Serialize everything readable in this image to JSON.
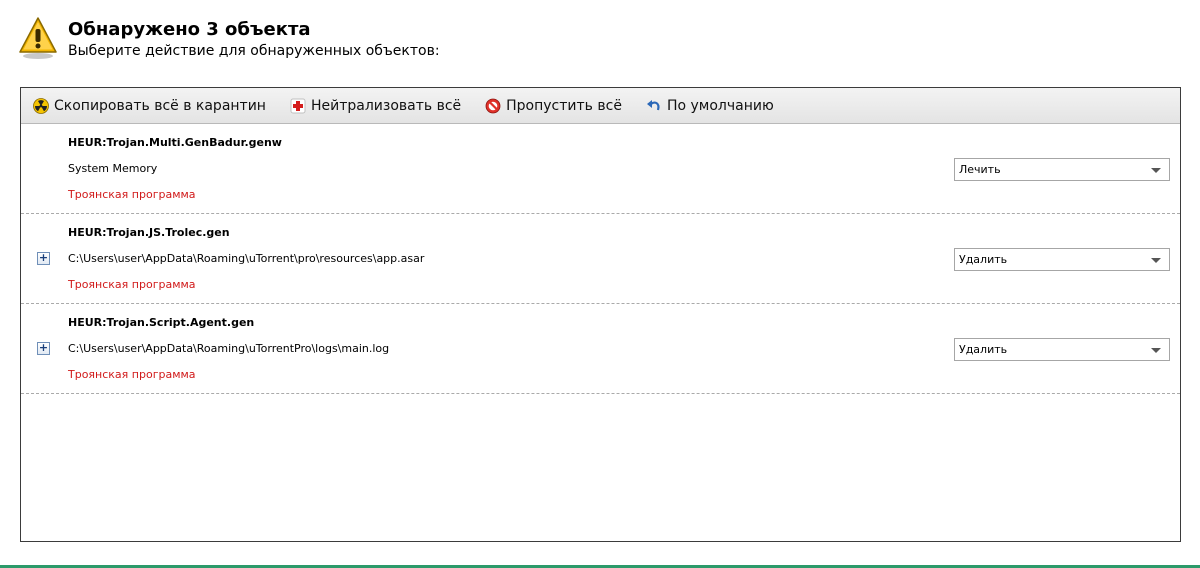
{
  "header": {
    "icon": "warning-triangle-icon",
    "title": "Обнаружено 3 объекта",
    "subtitle": "Выберите действие для обнаруженных объектов:"
  },
  "toolbar": {
    "quarantine_label": "Скопировать всё в карантин",
    "neutralize_label": "Нейтрализовать всё",
    "skip_label": "Пропустить всё",
    "default_label": "По умолчанию"
  },
  "items": [
    {
      "name": "HEUR:Trojan.Multi.GenBadur.genw",
      "path": "System Memory",
      "type": "Троянская программа",
      "action": "Лечить"
    },
    {
      "name": "HEUR:Trojan.JS.Trolec.gen",
      "path": "C:\\Users\\user\\AppData\\Roaming\\uTorrent\\pro\\resources\\app.asar",
      "type": "Троянская программа",
      "action": "Удалить"
    },
    {
      "name": "HEUR:Trojan.Script.Agent.gen",
      "path": "C:\\Users\\user\\AppData\\Roaming\\uTorrentPro\\logs\\main.log",
      "type": "Троянская программа",
      "action": "Удалить"
    }
  ],
  "colors": {
    "threat_type": "#d11a1a",
    "accent_bar": "#2c9a6a",
    "warning": "#f2b400"
  }
}
